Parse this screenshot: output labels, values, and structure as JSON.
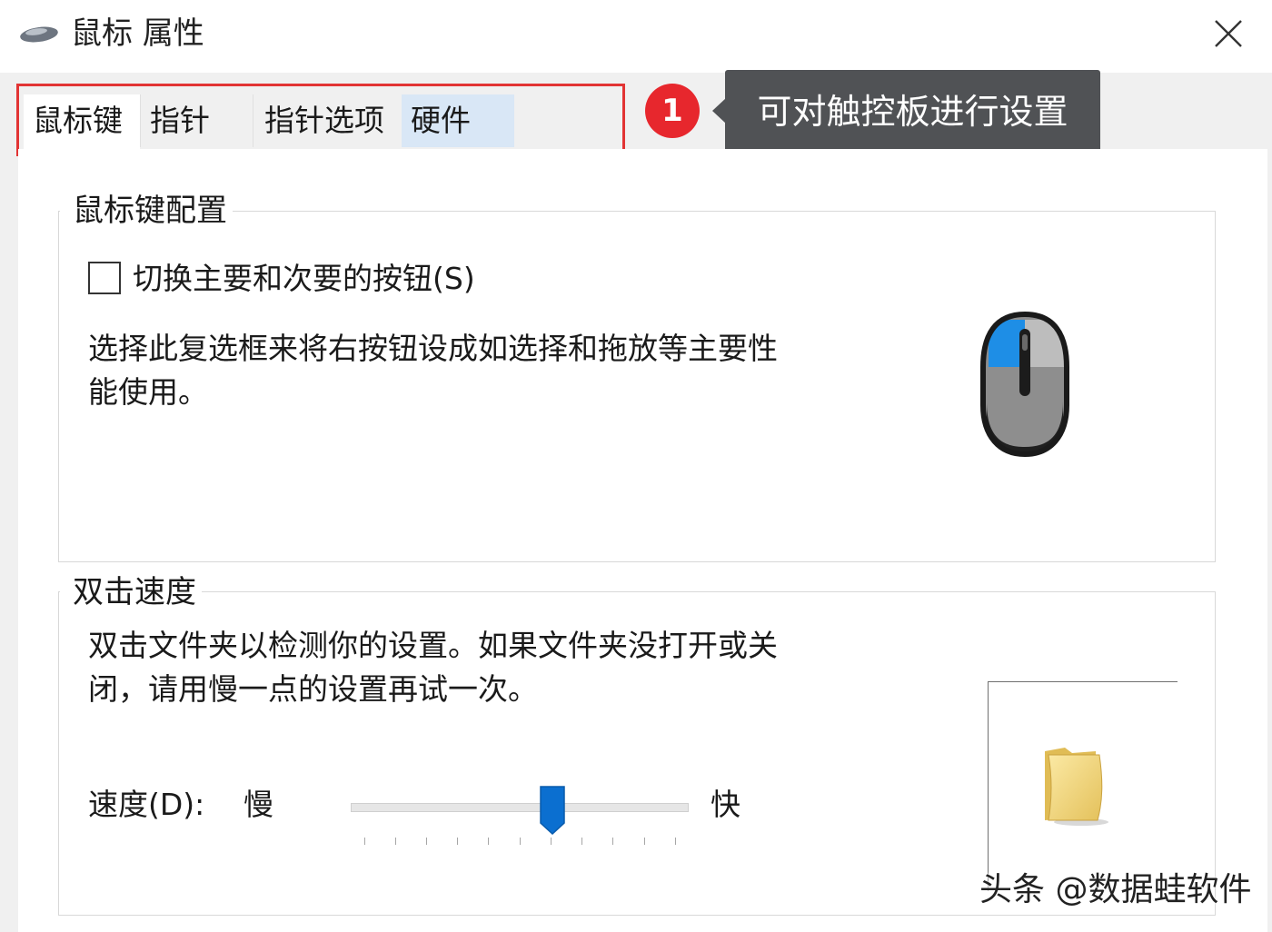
{
  "window": {
    "title": "鼠标 属性",
    "close_glyph": "✕"
  },
  "tabs": [
    {
      "label": "鼠标键",
      "state": "active"
    },
    {
      "label": "指针",
      "state": "inactive"
    },
    {
      "label": "指针选项",
      "state": "inactive"
    },
    {
      "label": "硬件",
      "state": "hover"
    }
  ],
  "annotation": {
    "step_number": "1",
    "tooltip": "可对触控板进行设置",
    "highlight_color": "#e23434",
    "badge_color": "#e7272d"
  },
  "button_config": {
    "legend": "鼠标键配置",
    "checkbox_label": "切换主要和次要的按钮(S)",
    "checkbox_checked": false,
    "description_line1": "选择此复选框来将右按钮设成如选择和拖放等主要性",
    "description_line2": "能使用。",
    "illustration_icon": "mouse-icon"
  },
  "double_click": {
    "legend": "双击速度",
    "description_line1": "双击文件夹以检测你的设置。如果文件夹没打开或关",
    "description_line2": "闭，请用慢一点的设置再试一次。",
    "speed_label": "速度(D):",
    "slow_label": "慢",
    "fast_label": "快",
    "slider_position": 0.6,
    "test_icon": "folder-icon"
  },
  "watermark": "头条 @数据蛙软件",
  "colors": {
    "accent": "#0078d7",
    "panel": "#ffffff",
    "dialog_bg": "#f0f0f0"
  }
}
